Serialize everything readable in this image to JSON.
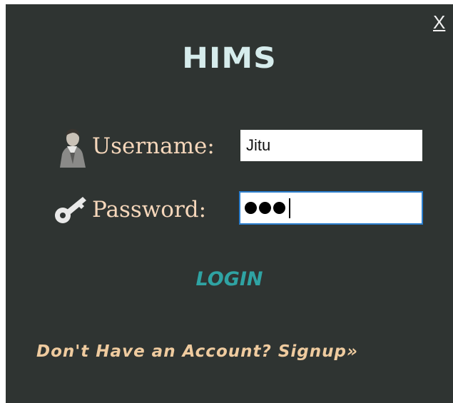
{
  "window": {
    "close_label": "X",
    "title": "HIMS"
  },
  "form": {
    "username_label": "Username:",
    "username_value": "Jitu",
    "password_label": "Password:",
    "password_length": 3
  },
  "actions": {
    "login_label": "LOGIN",
    "signup_label": "Don't Have an Account? Signup»"
  },
  "icons": {
    "user": "user-person-icon",
    "key": "key-icon"
  },
  "colors": {
    "background": "#2f3432",
    "title": "#d6ecec",
    "label": "#f6d7bb",
    "login": "#2fa3a3",
    "signup": "#efcb9f",
    "focus_border": "#2c7fcf"
  }
}
